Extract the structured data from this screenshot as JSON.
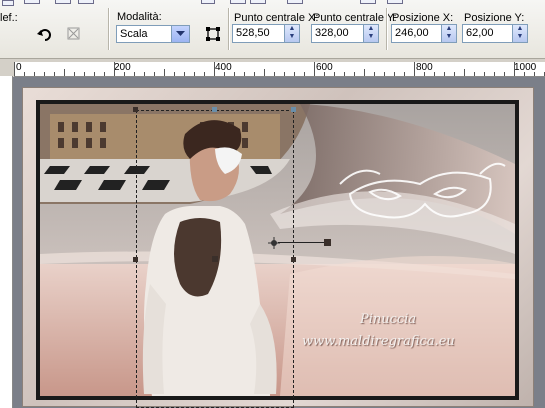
{
  "toolbar": {
    "cut_label": "lef.:",
    "mode_label": "Modalità:",
    "mode_value": "Scala",
    "center_x_label": "Punto centrale X:",
    "center_x_value": "528,50",
    "center_y_label": "Punto centrale Y:",
    "center_y_value": "328,00",
    "pos_x_label": "Posizione X:",
    "pos_x_value": "246,00",
    "pos_y_label": "Posizione Y:",
    "pos_y_value": "62,00"
  },
  "ruler": {
    "labels": [
      "0",
      "200",
      "400",
      "600",
      "800",
      "1000"
    ]
  },
  "artwork": {
    "watermark_line1": "Pinuccia",
    "watermark_line2": "www.maldiregrafica.eu"
  },
  "colors": {
    "accent": "#7f9db9",
    "canvas_bg": "#7b7f89"
  },
  "icons": [
    "undo-arrow-icon",
    "reset-icon",
    "pick-tool-icon"
  ]
}
